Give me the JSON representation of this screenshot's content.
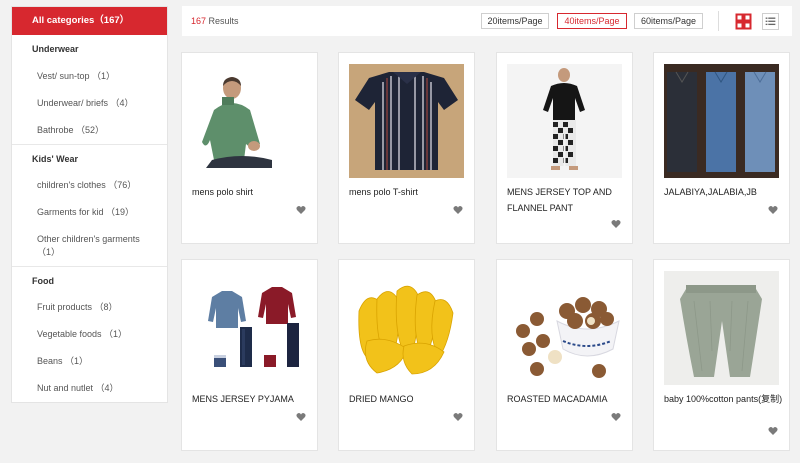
{
  "sidebar": {
    "all": "All categories（167）",
    "groups": [
      {
        "title": "Underwear",
        "items": [
          "Vest/ sun-top （1）",
          "Underwear/ briefs （4）",
          "Bathrobe （52）"
        ]
      },
      {
        "title": "Kids' Wear",
        "items": [
          "children's clothes （76）",
          "Garments for kid （19）",
          "Other children's garments",
          "（1）"
        ]
      },
      {
        "title": "Food",
        "items": [
          "Fruit products （8）",
          "Vegetable foods （1）",
          "Beans （1）",
          "Nut and nutlet （4）"
        ]
      }
    ]
  },
  "toolbar": {
    "count": "167",
    "results_label": "Results",
    "page_options": [
      "20items/Page",
      "40items/Page",
      "60items/Page"
    ],
    "active_page_option": "40items/Page"
  },
  "products": [
    {
      "title": "mens polo shirt",
      "image": "man in green polo shirt"
    },
    {
      "title": "mens polo T-shirt",
      "image": "navy striped polo t-shirt"
    },
    {
      "title": "MENS JERSEY TOP AND FLANNEL PANT",
      "image": "man in black top and plaid pants"
    },
    {
      "title": "JALABIYA,JALABIA,JB",
      "image": "three jalabiya robes"
    },
    {
      "title": "MENS JERSEY PYJAMA",
      "image": "two pyjama sets"
    },
    {
      "title": "DRIED MANGO",
      "image": "dried mango slices"
    },
    {
      "title": "ROASTED MACADAMIA",
      "image": "macadamia nuts in bowl"
    },
    {
      "title": "baby 100%cotton pants(复制)",
      "image": "grey baby cotton pants"
    }
  ],
  "colors": {
    "accent": "#d7282f",
    "heart": "#7a7a7a"
  }
}
